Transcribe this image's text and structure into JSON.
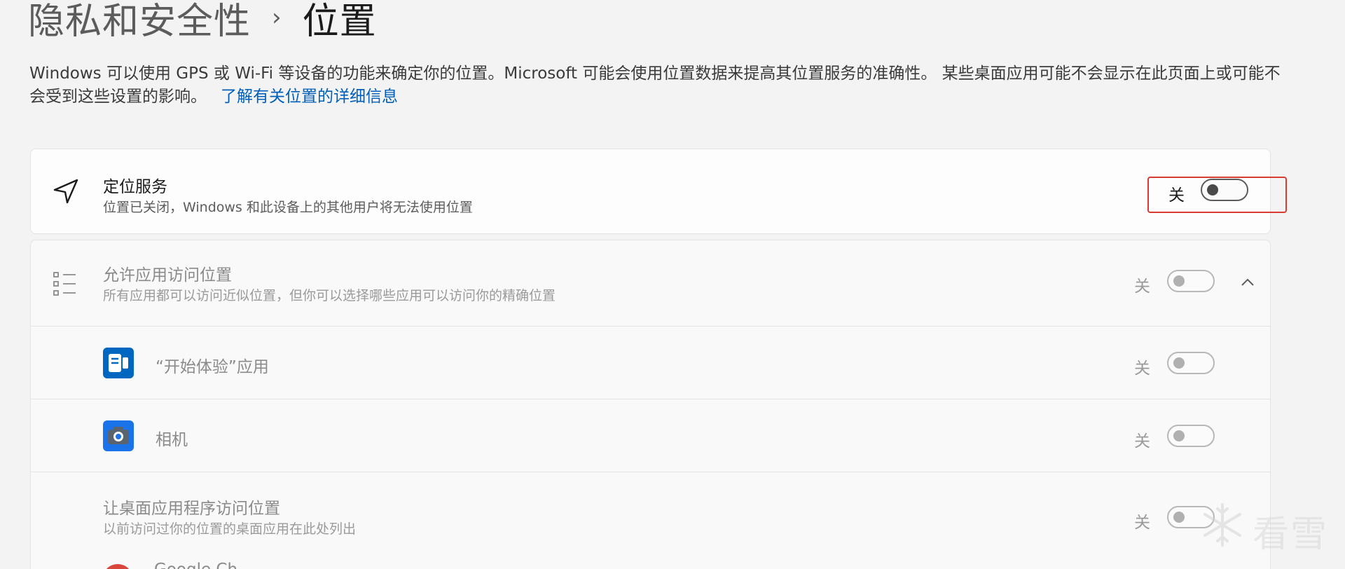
{
  "breadcrumb": {
    "parent": "隐私和安全性",
    "separator": "›",
    "current": "位置"
  },
  "description": {
    "text": "Windows 可以使用 GPS 或 Wi-Fi 等设备的功能来确定你的位置。Microsoft 可能会使用位置数据来提高其位置服务的准确性。 某些桌面应用可能不会显示在此页面上或可能不会受到这些设置的影响。",
    "link": "了解有关位置的详细信息"
  },
  "location_service": {
    "icon": "location-arrow-icon",
    "title": "定位服务",
    "subtitle": "位置已关闭，Windows 和此设备上的其他用户将无法使用位置",
    "state": "关"
  },
  "app_access": {
    "icon": "list-icon",
    "title": "允许应用访问位置",
    "subtitle": "所有应用都可以访问近似位置，但你可以选择哪些应用可以访问你的精确位置",
    "state": "关",
    "chevron": "chevron-up-icon"
  },
  "apps": [
    {
      "icon": "get-started-icon",
      "name": "“开始体验”应用",
      "state": "关",
      "color": "#0067c0"
    },
    {
      "icon": "camera-icon",
      "name": "相机",
      "state": "关",
      "color": "#1a73e8"
    }
  ],
  "desktop_access": {
    "title": "让桌面应用程序访问位置",
    "subtitle": "以前访问过你的位置的桌面应用在此处列出",
    "state": "关"
  },
  "desktop_apps": [
    {
      "icon": "chrome-icon",
      "name": "Google Ch"
    }
  ],
  "watermark": {
    "text": "看雪"
  },
  "colors": {
    "accent": "#005fb8",
    "highlight_border": "#d93a32",
    "background": "#f3f3f3"
  }
}
